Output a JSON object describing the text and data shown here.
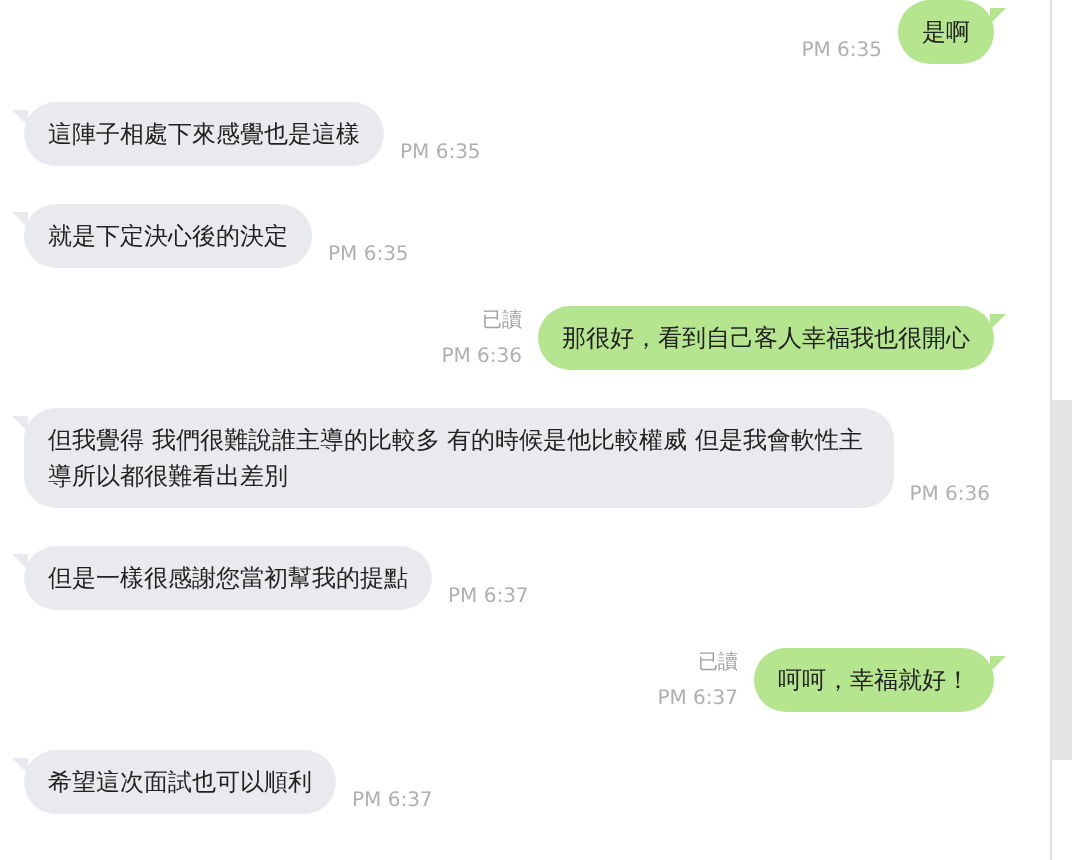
{
  "messages": [
    {
      "kind": "outgoing",
      "text": "是啊",
      "time": "PM 6:35"
    },
    {
      "kind": "incoming",
      "text": "這陣子相處下來感覺也是這樣",
      "time": "PM 6:35"
    },
    {
      "kind": "incoming",
      "text": "就是下定決心後的決定",
      "time": "PM 6:35"
    },
    {
      "kind": "outgoing",
      "text": "那很好，看到自己客人幸福我也很開心",
      "read_label": "已讀",
      "time": "PM 6:36"
    },
    {
      "kind": "incoming",
      "text": "但我覺得 我們很難說誰主導的比較多 有的時候是他比較權威 但是我會軟性主導所以都很難看出差別",
      "time": "PM 6:36"
    },
    {
      "kind": "incoming",
      "text": "但是一樣很感謝您當初幫我的提點",
      "time": "PM 6:37"
    },
    {
      "kind": "outgoing",
      "text": "呵呵，幸福就好！",
      "read_label": "已讀",
      "time": "PM 6:37"
    },
    {
      "kind": "incoming",
      "text": "希望這次面試也可以順利",
      "time": "PM 6:37"
    }
  ]
}
